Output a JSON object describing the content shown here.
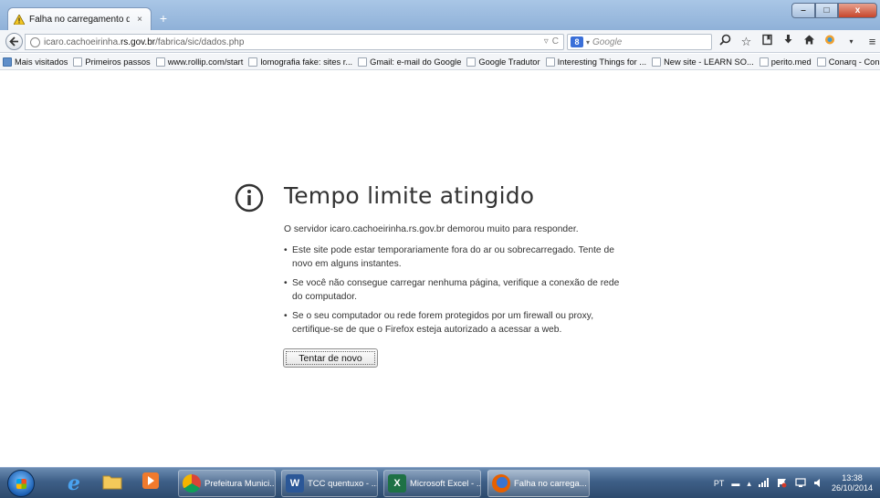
{
  "browser": {
    "tab": {
      "title": "Falha no carregamento da ...",
      "close": "×"
    },
    "new_tab": "+",
    "url": {
      "host_pre": "icaro.cachoeirinha.",
      "host_main": "rs.gov.br",
      "path": "/fabrica/sic/dados.php"
    },
    "search": {
      "placeholder": "Google",
      "engine_badge": "8"
    },
    "window_controls": {
      "minimize": "–",
      "maximize": "□",
      "close": "x"
    }
  },
  "bookmarks": [
    "Mais visitados",
    "Primeiros passos",
    "www.rollip.com/start",
    "lomografia fake: sites r...",
    "Gmail: e-mail do Google",
    "Google Tradutor",
    "Interesting Things for ...",
    "New site - LEARN SO...",
    "perito.med",
    "Conarq - Conselho Na..."
  ],
  "error": {
    "title": "Tempo limite atingido",
    "description": "O servidor icaro.cachoeirinha.rs.gov.br demorou muito para responder.",
    "items": [
      "Este site pode estar temporariamente fora do ar ou sobrecarregado. Tente de novo em alguns instantes.",
      "Se você não consegue carregar nenhuma página, verifique a conexão de rede do computador.",
      "Se o seu computador ou rede forem protegidos por um firewall ou proxy, certifique-se de que o Firefox esteja autorizado a acessar a web."
    ],
    "retry_button": "Tentar de novo"
  },
  "taskbar": {
    "items": [
      {
        "label": "Prefeitura Munici...",
        "icon": "chrome-icon",
        "color": "#d9472b"
      },
      {
        "label": "TCC quentuxo - ...",
        "icon": "word-icon",
        "color": "#2b5797"
      },
      {
        "label": "Microsoft Excel - ...",
        "icon": "excel-icon",
        "color": "#1e7145"
      },
      {
        "label": "Falha no carrega...",
        "icon": "firefox-icon",
        "color": "#e66000"
      }
    ],
    "tray": {
      "language": "PT",
      "time": "13:38",
      "date": "26/10/2014"
    }
  },
  "colors": {
    "accent": "#3a6fd8",
    "titlebar": "#a9c6e6",
    "taskbar": "#3e5f87"
  }
}
